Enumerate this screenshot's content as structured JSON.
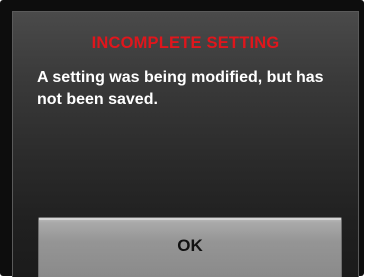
{
  "dialog": {
    "title": "INCOMPLETE SETTING",
    "message": "A setting was being modified, but has not been saved.",
    "ok_label": "OK"
  },
  "colors": {
    "title": "#e0161c",
    "message": "#ffffff",
    "button": "#959595"
  }
}
